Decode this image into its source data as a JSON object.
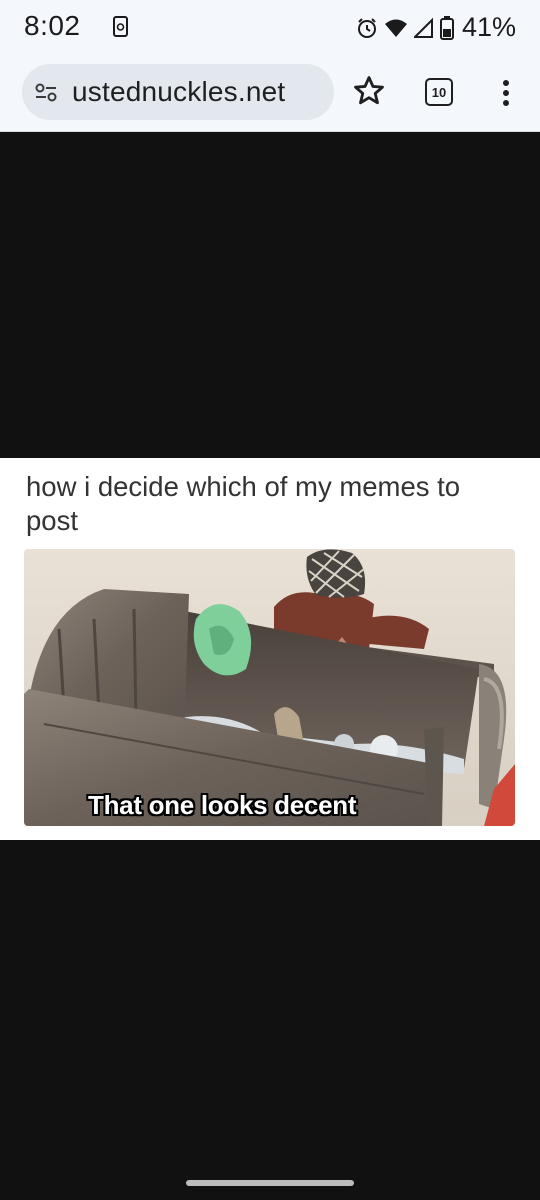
{
  "status_bar": {
    "time": "8:02",
    "battery": "41%",
    "icons": [
      "screen-record-icon",
      "alarm-icon",
      "wifi-icon",
      "signal-icon",
      "battery-icon"
    ]
  },
  "browser": {
    "url": "ustednuckles.net",
    "tab_count": "10",
    "icons": [
      "site-settings-icon",
      "bookmark-star-icon",
      "tabs-icon",
      "more-menu-icon"
    ]
  },
  "meme": {
    "caption": "how i decide which of my memes to post",
    "overlay_text": "That one looks decent"
  },
  "colors": {
    "page_background": "#111111",
    "chrome_background": "#f4f7fb",
    "url_pill": "#e3e8ef"
  }
}
